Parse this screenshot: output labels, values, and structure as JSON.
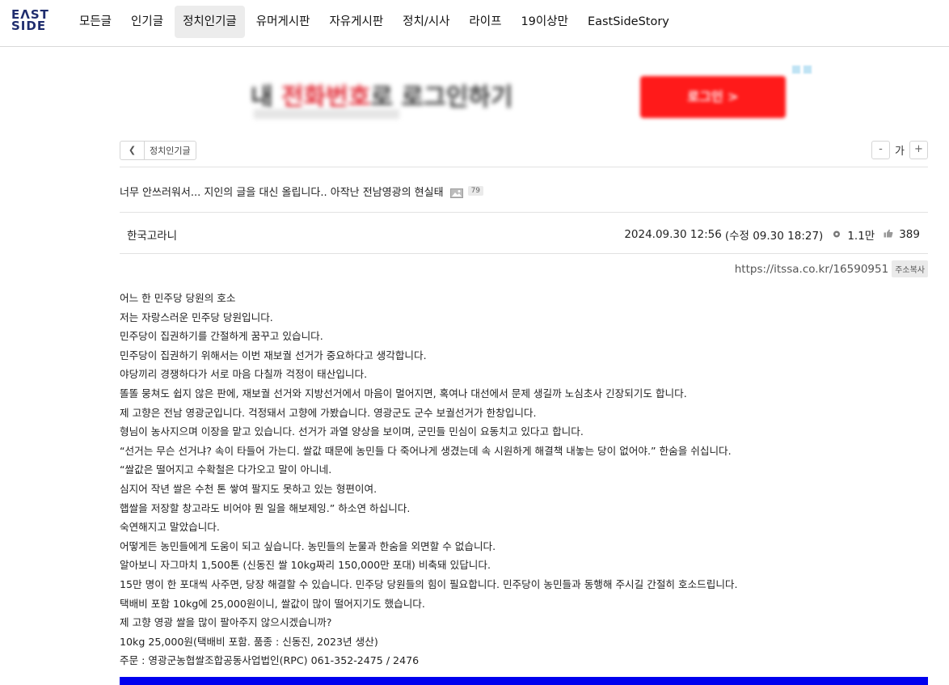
{
  "logo": {
    "line1": "EΛST",
    "line2": "SIDE"
  },
  "nav": [
    "모든글",
    "인기글",
    "정치인기글",
    "유머게시판",
    "자유게시판",
    "정치/시사",
    "라이프",
    "19이상만",
    "EastSideStory"
  ],
  "nav_active_index": 2,
  "ad": {
    "headline_black_1": "내 ",
    "headline_red": "전화번호",
    "headline_black_2": "로 로그인하기",
    "button": "로그인 >"
  },
  "breadcrumb": {
    "back_icon": "chevron-left",
    "board": "정치인기글"
  },
  "font_controls": {
    "minus": "-",
    "label": "가",
    "plus": "+"
  },
  "post": {
    "title": "너무 안쓰러워서... 지인의 글을 대신 올립니다.. 아작난 전남영광의 현실태",
    "comment_count": "79",
    "author": "한국고라니",
    "date": "2024.09.30 12:56",
    "edited": "(수정 09.30 18:27)",
    "views": "1.1만",
    "likes": "389",
    "url": "https://itssa.co.kr/16590951",
    "copy_label": "주소복사",
    "lines": [
      "어느 한 민주당 당원의 호소",
      "저는 자랑스러운 민주당 당원입니다.",
      "민주당이 집권하기를 간절하게 꿈꾸고 있습니다.",
      "민주당이 집권하기 위해서는 이번 재보궐 선거가 중요하다고 생각합니다.",
      "야당끼리 경쟁하다가 서로 마음 다칠까 걱정이 태산입니다.",
      "똘똘 뭉쳐도 쉽지 않은 판에, 재보궐 선거와 지방선거에서 마음이 멀어지면, 혹여나 대선에서 문제 생길까 노심초사 긴장되기도 합니다.",
      "제 고향은 전남 영광군입니다. 걱정돼서 고향에 가봤습니다. 영광군도 군수 보궐선거가 한창입니다.",
      "형님이 농사지으며 이장을 맡고 있습니다. 선거가 과열 양상을 보이며, 군민들 민심이 요동치고 있다고 합니다.",
      "“선거는 무슨 선거냐? 속이 타들어 가는디. 쌀값 때문에 농민들 다 죽어나게 생겼는데 속 시원하게 해결책 내놓는 당이 없어야.” 한숨을 쉬십니다.",
      "“쌀값은 떨어지고 수확철은 다가오고 말이 아니네.",
      "심지어 작년 쌀은 수천 톤 쌓여 팔지도 못하고 있는 형편이여.",
      "햅쌀을 저장할 창고라도 비어야 뭔 일을 해보제잉.” 하소연 하십니다.",
      "숙연해지고 말았습니다.",
      "어떻게든 농민들에게 도움이 되고 싶습니다. 농민들의 눈물과 한숨을 외면할 수 없습니다.",
      "알아보니 자그마치 1,500톤 (신동진 쌀 10kg짜리 150,000만 포대) 비축돼 있답니다.",
      "15만 명이 한 포대씩 사주면, 당장 해결할 수 있습니다. 민주당 당원들의 힘이 필요합니다. 민주당이 농민들과 동행해 주시길 간절히 호소드립니다.",
      "택배비 포함 10kg에 25,000원이니, 쌀값이 많이 떨어지기도 했습니다.",
      "제 고향 영광 쌀을 많이 팔아주지 않으시겠습니까?",
      "10kg 25,000원(택배비 포함. 품종 : 신동진, 2023년 생산)",
      "주문 : 영광군농협쌀조합공동사업법인(RPC) 061-352-2475 / 2476"
    ]
  },
  "colors": {
    "logo": "#1f2d6e",
    "ad_red": "#ff1a1a",
    "bottom_bar": "#0000ee",
    "nav_active_bg": "#ececec"
  }
}
